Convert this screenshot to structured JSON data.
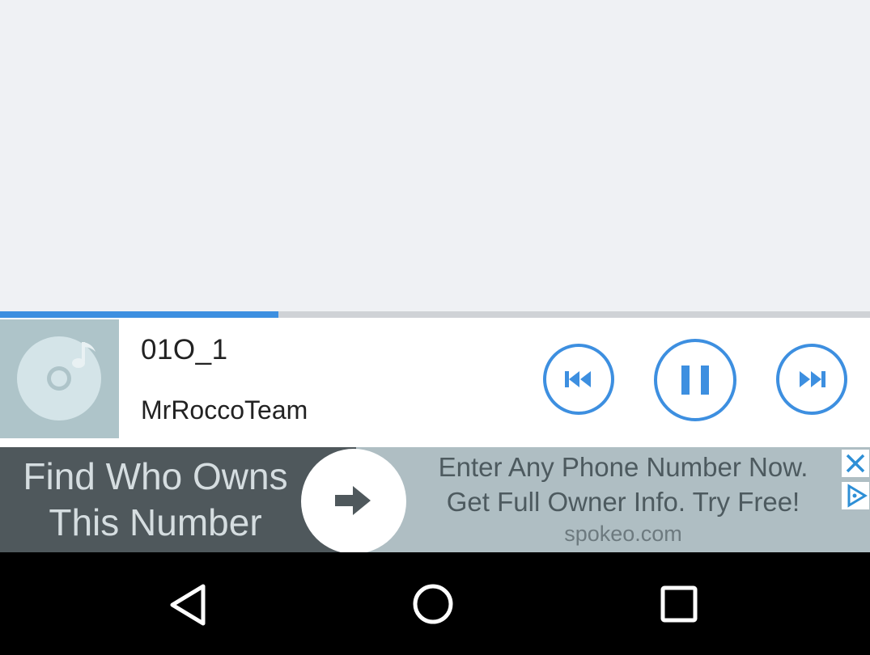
{
  "player": {
    "track_title": "01O_1",
    "artist": "MrRoccoTeam",
    "progress_percent": 32,
    "accent_color": "#3d8fe0",
    "icons": {
      "album_art": "music-disc-icon",
      "previous": "skip-previous-icon",
      "pause": "pause-icon",
      "next": "skip-next-icon"
    }
  },
  "ad": {
    "headline_line1": "Find Who Owns",
    "headline_line2": "This Number",
    "body_line1": "Enter Any Phone Number Now.",
    "body_line2": "Get Full Owner Info. Try Free!",
    "domain": "spokeo.com",
    "icons": {
      "arrow": "arrow-right-icon",
      "close": "close-icon",
      "adchoices": "adchoices-icon"
    }
  },
  "navbar": {
    "icons": [
      "back-icon",
      "home-icon",
      "recents-icon"
    ]
  }
}
